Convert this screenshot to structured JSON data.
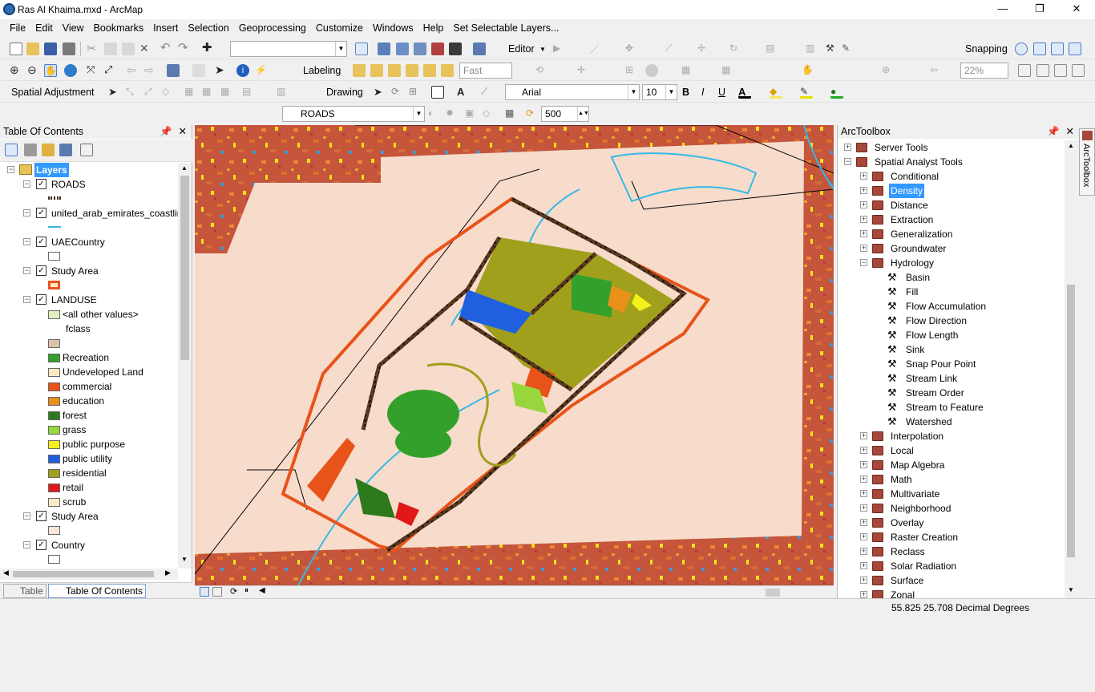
{
  "window": {
    "title": "Ras Al Khaima.mxd - ArcMap",
    "min": "—",
    "max": "❐",
    "close": "✕"
  },
  "menu": [
    "File",
    "Edit",
    "View",
    "Bookmarks",
    "Insert",
    "Selection",
    "Geoprocessing",
    "Customize",
    "Windows",
    "Help",
    "Set Selectable Layers..."
  ],
  "toolbars": {
    "editor_label": "Editor",
    "snapping_label": "Snapping",
    "labeling_label": "Labeling",
    "fast_value": "Fast",
    "zoom_percent": "22%",
    "spatial_adjustment_label": "Spatial Adjustment",
    "drawing_label": "Drawing",
    "font_name": "Arial",
    "font_size": "10",
    "bold": "B",
    "italic": "I",
    "underline": "U",
    "layer_value": "ROADS",
    "scale_value": "500"
  },
  "toc": {
    "title": "Table Of Contents",
    "root": "Layers",
    "layers": [
      {
        "name": "ROADS"
      },
      {
        "name": "united_arab_emirates_coastlin"
      },
      {
        "name": "UAECountry"
      },
      {
        "name": "Study Area"
      },
      {
        "name": "LANDUSE"
      }
    ],
    "landuse_header": "<all other values>",
    "landuse_field": "fclass",
    "landuse_classes": [
      {
        "label": "",
        "color": "#d9c3a8"
      },
      {
        "label": "Recreation",
        "color": "#33a02c"
      },
      {
        "label": "Undeveloped Land",
        "color": "#fde9c2"
      },
      {
        "label": "commercial",
        "color": "#e8531a"
      },
      {
        "label": "education",
        "color": "#e8901a"
      },
      {
        "label": "forest",
        "color": "#2d7a1c"
      },
      {
        "label": "grass",
        "color": "#98d63e"
      },
      {
        "label": "public purpose",
        "color": "#f2f21a"
      },
      {
        "label": "public utility",
        "color": "#1f5fe0"
      },
      {
        "label": "residential",
        "color": "#a0a01c"
      },
      {
        "label": "retail",
        "color": "#e01818"
      },
      {
        "label": "scrub",
        "color": "#fde9c8"
      }
    ],
    "bottom_layers": [
      {
        "name": "Study Area"
      },
      {
        "name": "Country"
      }
    ],
    "tabs": [
      "Table",
      "Table Of Contents"
    ]
  },
  "arctoolbox": {
    "title": "ArcToolbox",
    "side_tab": "ArcToolbox",
    "items": [
      {
        "label": "Server Tools",
        "level": 0,
        "exp": "+"
      },
      {
        "label": "Spatial Analyst Tools",
        "level": 0,
        "exp": "-"
      },
      {
        "label": "Conditional",
        "level": 1,
        "exp": "+"
      },
      {
        "label": "Density",
        "level": 1,
        "exp": "+",
        "selected": true
      },
      {
        "label": "Distance",
        "level": 1,
        "exp": "+"
      },
      {
        "label": "Extraction",
        "level": 1,
        "exp": "+"
      },
      {
        "label": "Generalization",
        "level": 1,
        "exp": "+"
      },
      {
        "label": "Groundwater",
        "level": 1,
        "exp": "+"
      },
      {
        "label": "Hydrology",
        "level": 1,
        "exp": "-"
      },
      {
        "label": "Basin",
        "level": 2
      },
      {
        "label": "Fill",
        "level": 2
      },
      {
        "label": "Flow Accumulation",
        "level": 2
      },
      {
        "label": "Flow Direction",
        "level": 2
      },
      {
        "label": "Flow Length",
        "level": 2
      },
      {
        "label": "Sink",
        "level": 2
      },
      {
        "label": "Snap Pour Point",
        "level": 2
      },
      {
        "label": "Stream Link",
        "level": 2
      },
      {
        "label": "Stream Order",
        "level": 2
      },
      {
        "label": "Stream to Feature",
        "level": 2
      },
      {
        "label": "Watershed",
        "level": 2
      },
      {
        "label": "Interpolation",
        "level": 1,
        "exp": "+"
      },
      {
        "label": "Local",
        "level": 1,
        "exp": "+"
      },
      {
        "label": "Map Algebra",
        "level": 1,
        "exp": "+"
      },
      {
        "label": "Math",
        "level": 1,
        "exp": "+"
      },
      {
        "label": "Multivariate",
        "level": 1,
        "exp": "+"
      },
      {
        "label": "Neighborhood",
        "level": 1,
        "exp": "+"
      },
      {
        "label": "Overlay",
        "level": 1,
        "exp": "+"
      },
      {
        "label": "Raster Creation",
        "level": 1,
        "exp": "+"
      },
      {
        "label": "Reclass",
        "level": 1,
        "exp": "+"
      },
      {
        "label": "Solar Radiation",
        "level": 1,
        "exp": "+"
      },
      {
        "label": "Surface",
        "level": 1,
        "exp": "+"
      },
      {
        "label": "Zonal",
        "level": 1,
        "exp": "+"
      }
    ]
  },
  "status": {
    "coords": "55.825  25.708 Decimal Degrees"
  }
}
